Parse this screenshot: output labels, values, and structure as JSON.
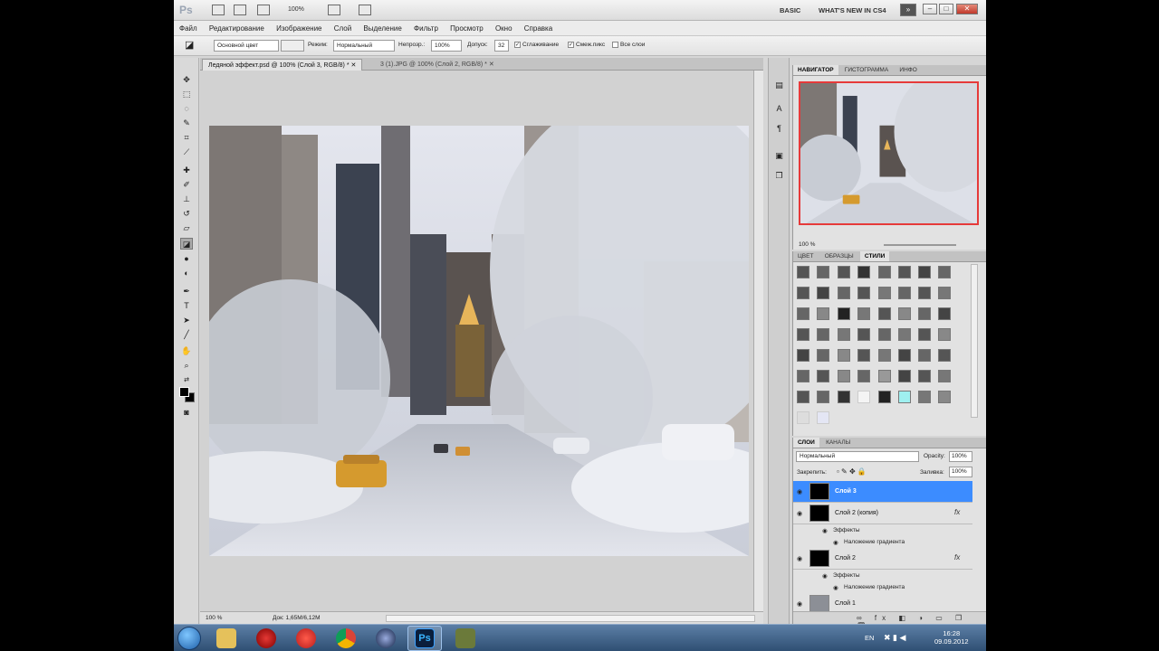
{
  "app": {
    "logo": "Ps",
    "zoom_level": "100%",
    "workspace": "BASIC",
    "whats_new": "WHAT'S NEW IN CS4"
  },
  "menu": [
    "Файл",
    "Редактирование",
    "Изображение",
    "Слой",
    "Выделение",
    "Фильтр",
    "Просмотр",
    "Окно",
    "Справка"
  ],
  "options": {
    "fill_source": "Основной цвет",
    "mode_label": "Режим:",
    "mode_value": "Нормальный",
    "opacity_label": "Непрозр.:",
    "opacity_value": "100%",
    "tolerance_label": "Допуск:",
    "tolerance_value": "32",
    "antialias": "Сглаживание",
    "contiguous": "Смеж.пикс",
    "all_layers": "Все слои"
  },
  "document": {
    "tabs": [
      {
        "label": "Ледяной эффект.psd @ 100% (Слой 3, RGB/8) *",
        "active": true
      },
      {
        "label": "3 (1).JPG @ 100% (Слой 2, RGB/8) *",
        "active": false
      }
    ],
    "status_zoom": "100 %",
    "doc_size": "Док: 1,65M/6,12M"
  },
  "navigator": {
    "tabs": [
      "НАВИГАТОР",
      "ГИСТОГРАММА",
      "ИНФО"
    ],
    "zoom": "100 %"
  },
  "styles": {
    "tabs": [
      "ЦВЕТ",
      "ОБРАЗЦЫ",
      "СТИЛИ"
    ],
    "highlight_color": "#9ff0f0"
  },
  "layers": {
    "tabs": [
      "СЛОИ",
      "КАНАЛЫ"
    ],
    "blend_mode": "Нормальный",
    "opacity_label": "Opacity:",
    "opacity_value": "100%",
    "lock_label": "Закрепить:",
    "fill_label": "Заливка:",
    "fill_value": "100%",
    "effects_label": "Эффекты",
    "gradient_overlay": "Наложение градиента",
    "items": [
      "Слой 3",
      "Слой 2 (копия)",
      "Слой 2",
      "Слой 1"
    ],
    "selected_color": "#3c8cff"
  },
  "taskbar": {
    "lang": "EN",
    "time": "16:28",
    "date": "09.09.2012"
  }
}
